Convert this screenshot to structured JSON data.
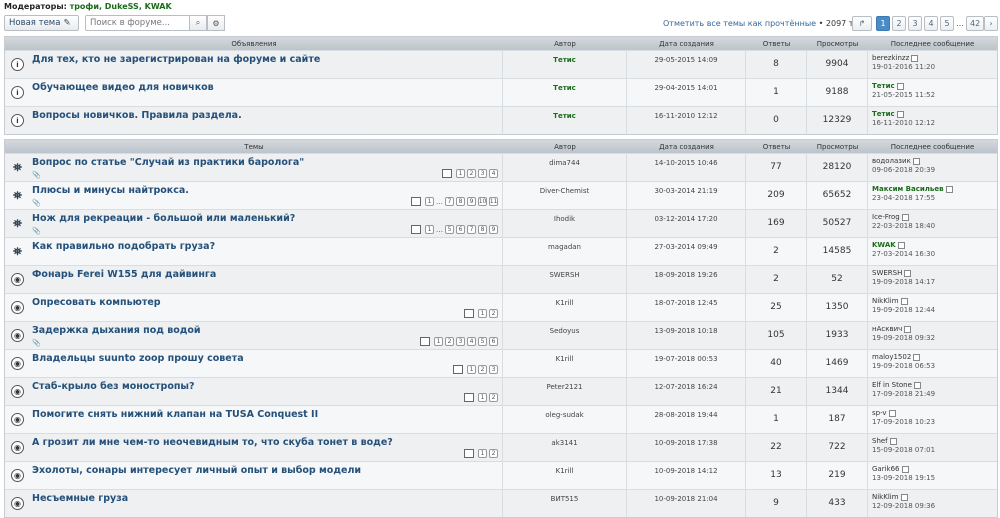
{
  "moderators": {
    "label": "Модераторы:",
    "names": "трофи, DukeSS, KWAK"
  },
  "toolbar": {
    "new_topic": "Новая тема",
    "search_placeholder": "Поиск в форуме...",
    "mark_read": "Отметить все темы как прочтённые",
    "topic_count": "• 2097 тем"
  },
  "pagination": [
    "1",
    "2",
    "3",
    "4",
    "5",
    "…",
    "42"
  ],
  "announce_header": {
    "title": "Объявления",
    "author": "Автор",
    "date": "Дата создания",
    "replies": "Ответы",
    "views": "Просмотры",
    "last": "Последнее сообщение"
  },
  "topics_header": {
    "title": "Темы",
    "author": "Автор",
    "date": "Дата создания",
    "replies": "Ответы",
    "views": "Просмотры",
    "last": "Последнее сообщение"
  },
  "announcements": [
    {
      "title": "Для тех, кто не зарегистрирован на форуме и сайте",
      "author": "Тетис",
      "date": "29-05-2015 14:09",
      "replies": "8",
      "views": "9904",
      "last_user": "berezkinzz",
      "last_date": "19-01-2016 11:20"
    },
    {
      "title": "Обучающее видео для новичков",
      "author": "Тетис",
      "date": "29-04-2015 14:01",
      "replies": "1",
      "views": "9188",
      "last_user": "Тетис",
      "last_date": "21-05-2015 11:52"
    },
    {
      "title": "Вопросы новичков. Правила раздела.",
      "author": "Тетис",
      "date": "16-11-2010 12:12",
      "replies": "0",
      "views": "12329",
      "last_user": "Тетис",
      "last_date": "16-11-2010 12:12"
    }
  ],
  "topics": [
    {
      "title": "Вопрос по статье \"Случай из практики баролога\"",
      "author": "dima744",
      "date": "14-10-2015 10:46",
      "replies": "77",
      "views": "28120",
      "last_user": "водолазик",
      "last_date": "09-06-2018 20:39",
      "pages": [
        "1",
        "2",
        "3",
        "4"
      ]
    },
    {
      "title": "Плюсы и минусы найтрокса.",
      "author": "Diver-Chemist",
      "date": "30-03-2014 21:19",
      "replies": "209",
      "views": "65652",
      "last_user": "Максим Васильев",
      "last_date": "23-04-2018 17:55",
      "pages": [
        "1",
        "…",
        "7",
        "8",
        "9",
        "10",
        "11"
      ]
    },
    {
      "title": "Нож для рекреации - большой или маленький?",
      "author": "Ihodik",
      "date": "03-12-2014 17:20",
      "replies": "169",
      "views": "50527",
      "last_user": "Ice-Frog",
      "last_date": "22-03-2018 18:40",
      "pages": [
        "1",
        "…",
        "5",
        "6",
        "7",
        "8",
        "9"
      ]
    },
    {
      "title": "Как правильно подобрать груза?",
      "author": "magadan",
      "date": "27-03-2014 09:49",
      "replies": "2",
      "views": "14585",
      "last_user": "KWAK",
      "last_date": "27-03-2014 16:30",
      "pages": []
    },
    {
      "title": "Фонарь Ferei W155 для дайвинга",
      "author": "SWERSH",
      "date": "18-09-2018 19:26",
      "replies": "2",
      "views": "52",
      "last_user": "SWERSH",
      "last_date": "19-09-2018 14:17",
      "pages": []
    },
    {
      "title": "Опресовать компьютер",
      "author": "K1rill",
      "date": "18-07-2018 12:45",
      "replies": "25",
      "views": "1350",
      "last_user": "NikKlim",
      "last_date": "19-09-2018 12:44",
      "pages": [
        "1",
        "2"
      ]
    },
    {
      "title": "Задержка дыхания под водой",
      "author": "Sedoyus",
      "date": "13-09-2018 10:18",
      "replies": "105",
      "views": "1933",
      "last_user": "нАсквич",
      "last_date": "19-09-2018 09:32",
      "pages": [
        "1",
        "2",
        "3",
        "4",
        "5",
        "6"
      ]
    },
    {
      "title": "Владельцы suunto zoop прошу совета",
      "author": "K1rill",
      "date": "19-07-2018 00:53",
      "replies": "40",
      "views": "1469",
      "last_user": "maloy1502",
      "last_date": "19-09-2018 06:53",
      "pages": [
        "1",
        "2",
        "3"
      ]
    },
    {
      "title": "Стаб-крыло без моностропы?",
      "author": "Peter2121",
      "date": "12-07-2018 16:24",
      "replies": "21",
      "views": "1344",
      "last_user": "Elf in Stone",
      "last_date": "17-09-2018 21:49",
      "pages": [
        "1",
        "2"
      ]
    },
    {
      "title": "Помогите снять нижний клапан на TUSA Conquest II",
      "author": "oleg-sudak",
      "date": "28-08-2018 19:44",
      "replies": "1",
      "views": "187",
      "last_user": "sp-v",
      "last_date": "17-09-2018 10:23",
      "pages": []
    },
    {
      "title": "А грозит ли мне чем-то неочевидным то, что скуба тонет в воде?",
      "author": "ak3141",
      "date": "10-09-2018 17:38",
      "replies": "22",
      "views": "722",
      "last_user": "Shef",
      "last_date": "15-09-2018 07:01",
      "pages": [
        "1",
        "2"
      ]
    },
    {
      "title": "Эхолоты, сонары интересует личный опыт и выбор модели",
      "author": "K1rill",
      "date": "10-09-2018 14:12",
      "replies": "13",
      "views": "219",
      "last_user": "Garik66",
      "last_date": "13-09-2018 19:15",
      "pages": []
    },
    {
      "title": "Несъемные груза",
      "author": "ВИТ515",
      "date": "10-09-2018 21:04",
      "replies": "9",
      "views": "433",
      "last_user": "NikKlim",
      "last_date": "12-09-2018 09:36",
      "pages": []
    }
  ]
}
